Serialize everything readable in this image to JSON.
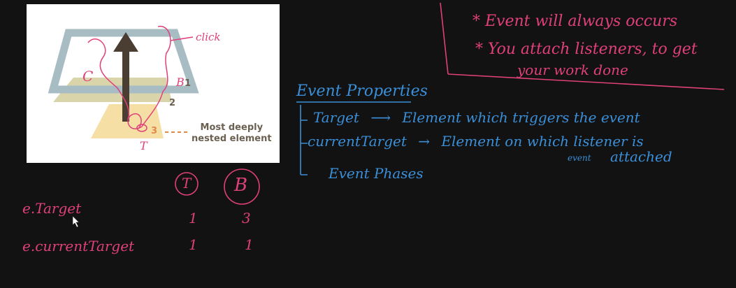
{
  "diagram": {
    "layer_labels": [
      "1",
      "2",
      "3"
    ],
    "nested_caption_line1": "Most deeply",
    "nested_caption_line2": "nested element",
    "annotations": {
      "click": "click",
      "C": "C",
      "B": "B",
      "T": "T"
    }
  },
  "notes": {
    "line1": "* Event will always occurs",
    "line2a": "* You attach listeners, to get",
    "line2b": "your work done"
  },
  "properties": {
    "heading": "Event Properties",
    "items": [
      {
        "name": "Target",
        "arrow": "⟶",
        "desc": "Element which triggers the event"
      },
      {
        "name": "currentTarget",
        "arrow": "→",
        "desc": "Element on which listener is"
      },
      {
        "name": "Event Phases"
      }
    ],
    "sub_event": "event",
    "sub_attached": "attached"
  },
  "table": {
    "col_headers": [
      "T",
      "B"
    ],
    "rows": [
      {
        "label": "e.Target",
        "values": [
          "1",
          "3"
        ]
      },
      {
        "label": "e.currentTarget",
        "values": [
          "1",
          "1"
        ]
      }
    ]
  },
  "colors": {
    "pink": "#e0407a",
    "blue": "#3a8fd8",
    "background": "#121212"
  }
}
